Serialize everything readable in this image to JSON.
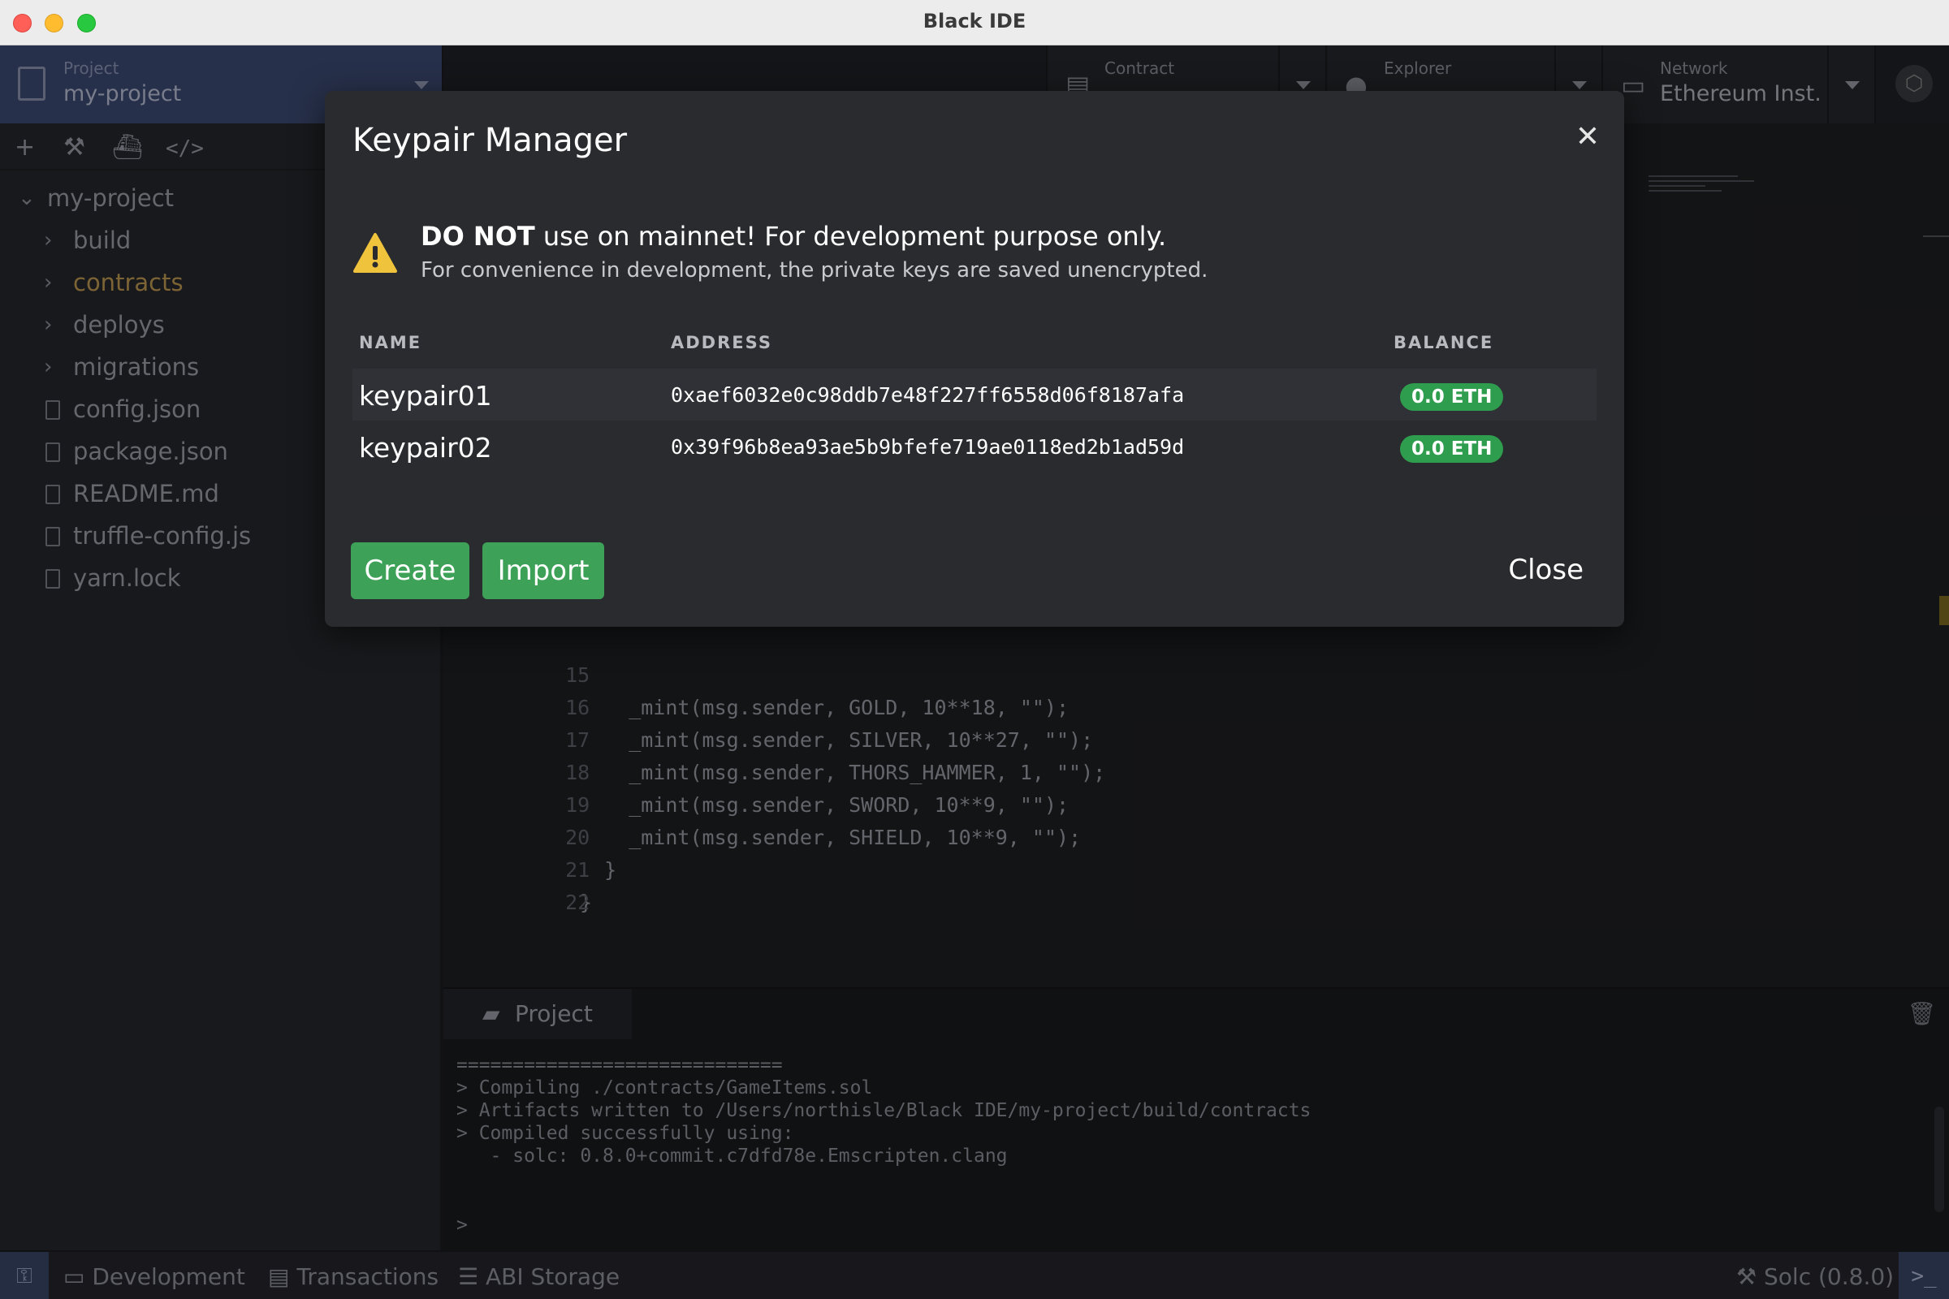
{
  "window": {
    "title": "Black IDE"
  },
  "project_selector": {
    "label": "Project",
    "value": "my-project"
  },
  "file_tree": {
    "root": "my-project",
    "items": [
      {
        "name": "build",
        "type": "folder"
      },
      {
        "name": "contracts",
        "type": "folder",
        "highlight": true
      },
      {
        "name": "deploys",
        "type": "folder"
      },
      {
        "name": "migrations",
        "type": "folder"
      },
      {
        "name": "config.json",
        "type": "file"
      },
      {
        "name": "package.json",
        "type": "file"
      },
      {
        "name": "README.md",
        "type": "file"
      },
      {
        "name": "truffle-config.js",
        "type": "file"
      },
      {
        "name": "yarn.lock",
        "type": "file"
      }
    ]
  },
  "header": {
    "contract": {
      "label": "Contract"
    },
    "explorer": {
      "label": "Explorer"
    },
    "network": {
      "label": "Network",
      "value": "Ethereum Inst..."
    }
  },
  "editor": {
    "lines": [
      {
        "n": "15",
        "code": "    _mint(msg.sender, GOLD, 10**18, \"\");"
      },
      {
        "n": "16",
        "code": "    _mint(msg.sender, SILVER, 10**27, \"\");"
      },
      {
        "n": "17",
        "code": "    _mint(msg.sender, THORS_HAMMER, 1, \"\");"
      },
      {
        "n": "18",
        "code": "    _mint(msg.sender, SWORD, 10**9, \"\");"
      },
      {
        "n": "19",
        "code": "    _mint(msg.sender, SHIELD, 10**9, \"\");"
      },
      {
        "n": "20",
        "code": "  }"
      },
      {
        "n": "21",
        "code": "}"
      },
      {
        "n": "22",
        "code": ""
      }
    ]
  },
  "bottom_panel": {
    "tab": "Project",
    "terminal_lines": [
      "=============================",
      "> Compiling ./contracts/GameItems.sol",
      "> Artifacts written to /Users/northisle/Black IDE/my-project/build/contracts",
      "> Compiled successfully using:",
      "   - solc: 0.8.0+commit.c7dfd78e.Emscripten.clang"
    ],
    "prompt": ">"
  },
  "status_bar": {
    "development": "Development",
    "transactions": "Transactions",
    "abi_storage": "ABI Storage",
    "compiler": "Solc (0.8.0)"
  },
  "modal": {
    "title": "Keypair Manager",
    "warning_bold": "DO NOT",
    "warning_rest": " use on mainnet! For development purpose only.",
    "warning_sub": "For convenience in development, the private keys are saved unencrypted.",
    "columns": {
      "name": "NAME",
      "address": "ADDRESS",
      "balance": "BALANCE"
    },
    "rows": [
      {
        "name": "keypair01",
        "address": "0xaef6032e0c98ddb7e48f227ff6558d06f8187afa",
        "balance": "0.0 ETH"
      },
      {
        "name": "keypair02",
        "address": "0x39f96b8ea93ae5b9bfefe719ae0118ed2b1ad59d",
        "balance": "0.0 ETH"
      }
    ],
    "create_label": "Create",
    "import_label": "Import",
    "close_label": "Close",
    "accent_color": "#3ea158",
    "badge_color": "#2f9d4e"
  }
}
